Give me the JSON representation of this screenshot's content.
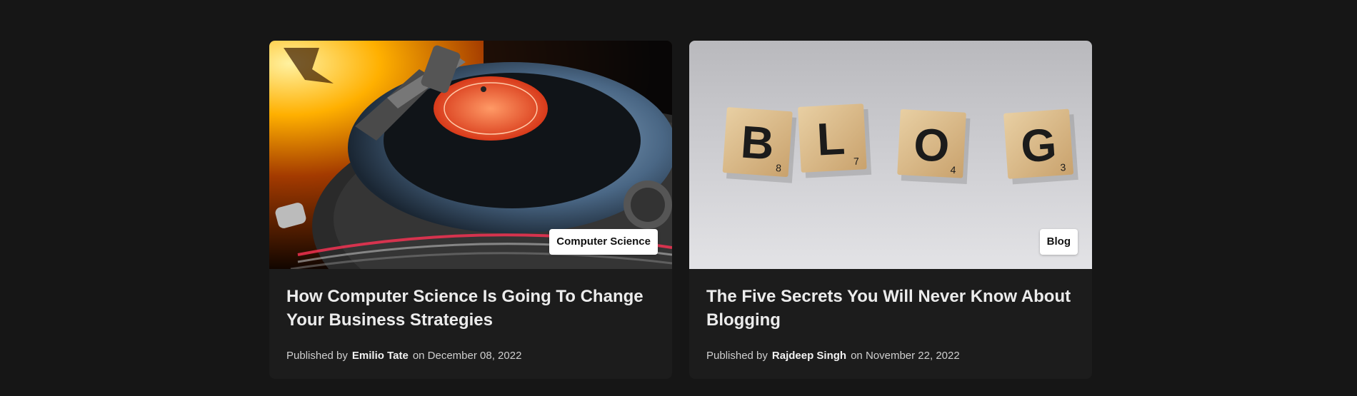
{
  "posts": [
    {
      "category": "Computer Science",
      "title": "How Computer Science Is Going To Change Your Business Strategies",
      "published_prefix": "Published by",
      "author": "Emilio Tate",
      "date_text": "on December 08, 2022",
      "image_icon": "turntable-photo"
    },
    {
      "category": "Blog",
      "title": "The Five Secrets You Will Never Know About Blogging",
      "published_prefix": "Published by",
      "author": "Rajdeep Singh",
      "date_text": "on November 22, 2022",
      "image_icon": "scrabble-tiles-blog-photo",
      "tiles": [
        {
          "letter": "B",
          "score": "8"
        },
        {
          "letter": "L",
          "score": "7"
        },
        {
          "letter": "O",
          "score": "4"
        },
        {
          "letter": "G",
          "score": "3"
        }
      ]
    }
  ],
  "colors": {
    "page_bg": "#161616",
    "card_bg": "#1c1c1c",
    "tag_bg": "#ffffff",
    "title": "#ececec"
  }
}
